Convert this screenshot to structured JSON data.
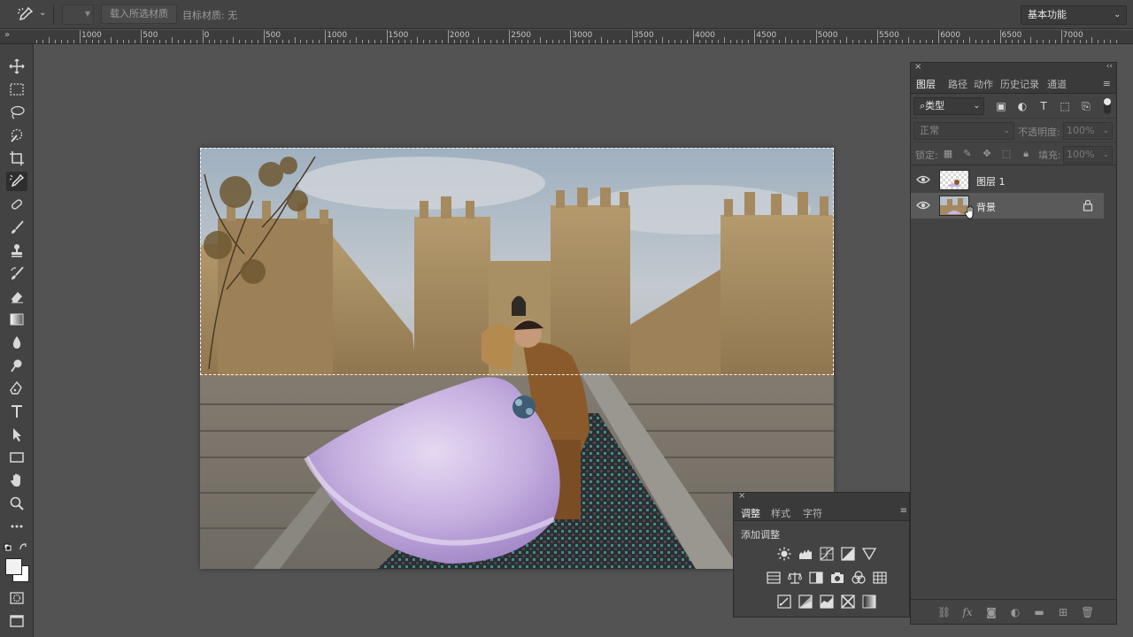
{
  "options_bar": {
    "load_button": "载入所选材质",
    "target_label": "目标材质: 无",
    "workspace": "基本功能"
  },
  "ruler": {
    "labels": [
      "1000",
      "500",
      "0",
      "500",
      "1000",
      "1500",
      "2000",
      "2500",
      "3000",
      "3500",
      "4000",
      "4500",
      "5000",
      "5500",
      "6000",
      "6500",
      "7000"
    ],
    "corner": "»"
  },
  "toolbar": {
    "tools": [
      "move-tool",
      "marquee-tool",
      "lasso-tool",
      "quick-selection-tool",
      "crop-tool",
      "eyedropper-tool",
      "healing-brush-tool",
      "brush-tool",
      "clone-stamp-tool",
      "history-brush-tool",
      "eraser-tool",
      "gradient-tool",
      "blur-tool",
      "dodge-tool",
      "pen-tool",
      "type-tool",
      "path-selection-tool",
      "rectangle-tool",
      "hand-tool",
      "zoom-tool",
      "more-tools"
    ]
  },
  "layers_panel": {
    "tabs": [
      "图层",
      "路径",
      "动作",
      "历史记录",
      "通道"
    ],
    "kind_filter": "类型",
    "blend_mode": "正常",
    "opacity_label": "不透明度:",
    "opacity_value": "100%",
    "lock_label": "锁定:",
    "fill_label": "填充:",
    "fill_value": "100%",
    "layers": [
      {
        "name": "图层 1",
        "selected": false,
        "locked": false
      },
      {
        "name": "背景",
        "selected": true,
        "locked": true
      }
    ],
    "footer_fx": "fx"
  },
  "adjustments_panel": {
    "tabs": [
      "调整",
      "样式",
      "字符"
    ],
    "title": "添加调整"
  },
  "colors": {
    "panel_bg": "#434343",
    "canvas_bg": "#535353",
    "selected_layer": "#5a5a5a"
  }
}
